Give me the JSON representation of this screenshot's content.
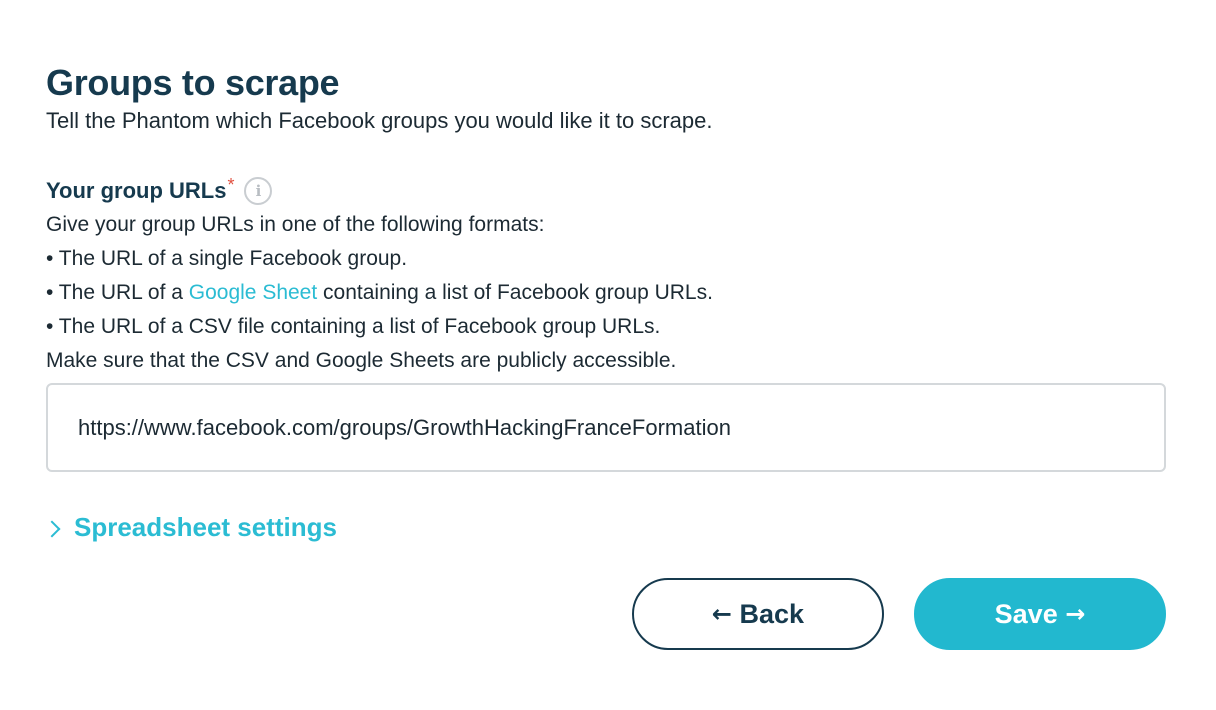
{
  "section": {
    "title": "Groups to scrape",
    "subtitle": "Tell the Phantom which Facebook groups you would like it to scrape."
  },
  "field": {
    "label": "Your group URLs",
    "required_mark": "*",
    "info_icon": "info-icon",
    "info_glyph": "i",
    "desc_intro": "Give your group URLs in one of the following formats:",
    "bullet_1": "• The URL of a single Facebook group.",
    "bullet_2_prefix": "• The URL of a ",
    "bullet_2_link": "Google Sheet",
    "bullet_2_suffix": " containing a list of Facebook group URLs.",
    "bullet_3": "• The URL of a CSV file containing a list of Facebook group URLs.",
    "note": "Make sure that the CSV and Google Sheets are publicly accessible.",
    "value": "https://www.facebook.com/groups/GrowthHackingFranceFormation"
  },
  "spreadsheet_settings": {
    "label": "Spreadsheet settings",
    "icon": "chevron-right-icon"
  },
  "buttons": {
    "back_arrow": "←",
    "back_label": "Back",
    "save_label": "Save",
    "save_arrow": "→"
  },
  "colors": {
    "heading": "#163a4e",
    "accent": "#2bbcd3",
    "save_bg": "#22b8cf",
    "required": "#e0503f",
    "input_border": "#d4d8db"
  }
}
